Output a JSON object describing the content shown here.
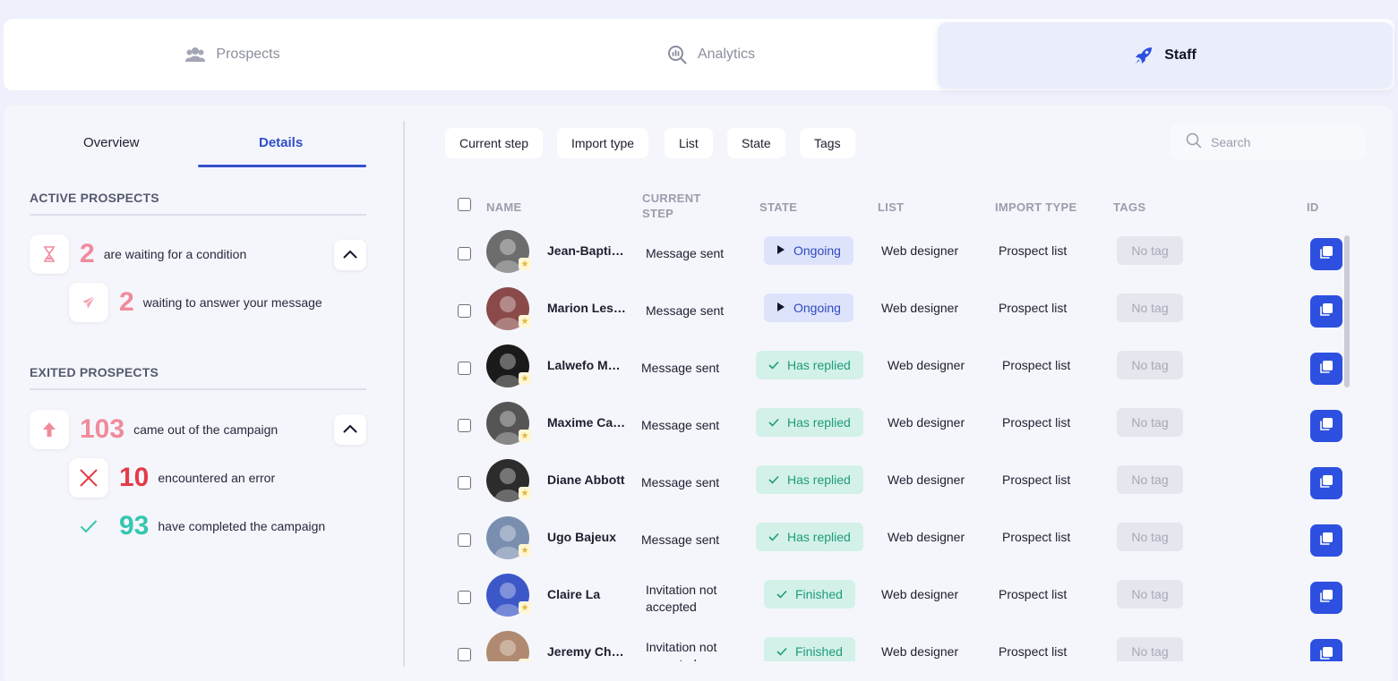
{
  "top_tabs": [
    {
      "label": "Prospects",
      "icon": "users-icon",
      "active": false
    },
    {
      "label": "Analytics",
      "icon": "analytics-search-icon",
      "active": false
    },
    {
      "label": "Staff",
      "icon": "rocket-icon",
      "active": true
    }
  ],
  "subtabs": {
    "overview": "Overview",
    "details": "Details"
  },
  "active_prospects": {
    "title": "ACTIVE PROSPECTS",
    "items": [
      {
        "count": "2",
        "label": "are waiting for a condition",
        "icon": "hourglass-icon"
      },
      {
        "count": "2",
        "label": "waiting to answer your message",
        "icon": "paper-plane-icon"
      }
    ]
  },
  "exited_prospects": {
    "title": "EXITED PROSPECTS",
    "items": [
      {
        "count": "103",
        "label": "came out of the campaign",
        "icon": "arrow-up-icon"
      },
      {
        "count": "10",
        "label": "encountered an error",
        "icon": "close-icon"
      },
      {
        "count": "93",
        "label": "have completed the campaign",
        "icon": "check-icon"
      }
    ]
  },
  "filters": [
    "Current step",
    "Import type",
    "List",
    "State",
    "Tags"
  ],
  "search": {
    "placeholder": "Search"
  },
  "table": {
    "headers": {
      "name": "NAME",
      "current_step": "CURRENT STEP",
      "state": "STATE",
      "list": "LIST",
      "import_type": "IMPORT TYPE",
      "tags": "TAGS",
      "id": "ID"
    },
    "rows": [
      {
        "name": "Jean-Baptiste",
        "step": "Message sent",
        "state": "Ongoing",
        "state_kind": "ongoing",
        "list": "Web designer",
        "import_type": "Prospect list",
        "tag": "No tag"
      },
      {
        "name": "Marion Lesage",
        "step": "Message sent",
        "state": "Ongoing",
        "state_kind": "ongoing",
        "list": "Web designer",
        "import_type": "Prospect list",
        "tag": "No tag"
      },
      {
        "name": "Lalwefo Mbeki",
        "step": "Message sent",
        "state": "Has replied",
        "state_kind": "replied",
        "list": "Web designer",
        "import_type": "Prospect list",
        "tag": "No tag"
      },
      {
        "name": "Maxime Caron",
        "step": "Message sent",
        "state": "Has replied",
        "state_kind": "replied",
        "list": "Web designer",
        "import_type": "Prospect list",
        "tag": "No tag"
      },
      {
        "name": "Diane Abbott",
        "step": "Message sent",
        "state": "Has replied",
        "state_kind": "replied",
        "list": "Web designer",
        "import_type": "Prospect list",
        "tag": "No tag"
      },
      {
        "name": "Ugo Bajeux",
        "step": "Message sent",
        "state": "Has replied",
        "state_kind": "replied",
        "list": "Web designer",
        "import_type": "Prospect list",
        "tag": "No tag"
      },
      {
        "name": "Claire La",
        "step": "Invitation not accepted",
        "state": "Finished",
        "state_kind": "replied",
        "list": "Web designer",
        "import_type": "Prospect list",
        "tag": "No tag"
      },
      {
        "name": "Jeremy Chevalier",
        "step": "Invitation not accepted",
        "state": "Finished",
        "state_kind": "replied",
        "list": "Web designer",
        "import_type": "Prospect list",
        "tag": "No tag"
      }
    ]
  },
  "colors": {
    "accent": "#2d50e0",
    "ongoing_bg": "#dde3fb",
    "replied_bg": "#d3f1e8",
    "pink": "#f08b9c",
    "red": "#e43b4a",
    "teal": "#34c7b0"
  }
}
